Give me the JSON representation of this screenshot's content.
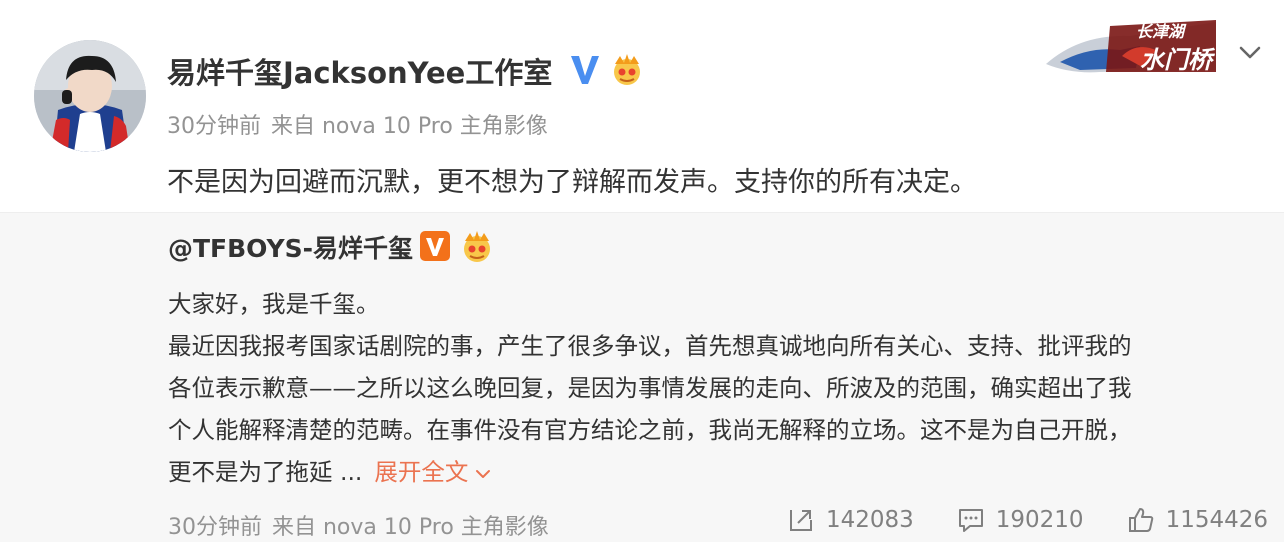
{
  "post": {
    "author": "易烊千玺JacksonYee工作室",
    "time": "30分钟前",
    "source": "来自 nova 10 Pro 主角影像",
    "text": "不是因为回避而沉默，更不想为了辩解而发声。支持你的所有决定。"
  },
  "banner": {
    "text_top": "长津湖",
    "text_bottom": "水门桥"
  },
  "repost": {
    "author": "@TFBOYS-易烊千玺",
    "lines": [
      "大家好，我是千玺。",
      "最近因我报考国家话剧院的事，产生了很多争议，首先想真诚地向所有关心、支持、批评我的",
      "各位表示歉意——之所以这么晚回复，是因为事情发展的走向、所波及的范围，确实超出了我",
      "个人能解释清楚的范畴。在事件没有官方结论之前，我尚无解释的立场。这不是为自己开脱，",
      "更不是为了拖延 ..."
    ],
    "expand_label": "展开全文",
    "time": "30分钟前",
    "source": "来自 nova 10 Pro 主角影像",
    "reposts": "142083",
    "comments": "190210",
    "likes": "1154426"
  },
  "colors": {
    "accent": "#eb7350",
    "verified_blue": "#4a8ef0",
    "verified_orange": "#f3711a",
    "meta": "#939393",
    "repost_bg": "#f7f7f7"
  },
  "icons": [
    "crown-icon",
    "verified-badge-icon",
    "chevron-down-icon",
    "repost-icon",
    "comment-icon",
    "like-icon"
  ]
}
